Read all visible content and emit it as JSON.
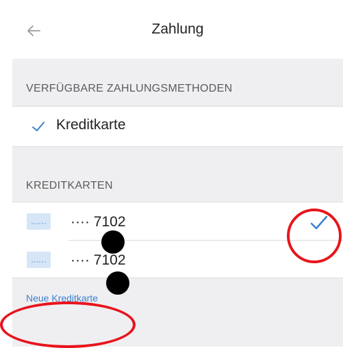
{
  "header": {
    "title": "Zahlung",
    "back_icon": "back-arrow-icon"
  },
  "payment_methods": {
    "section_title": "VERFÜGBARE ZAHLUNGSMETHODEN",
    "items": [
      {
        "label": "Kreditkarte",
        "selected": true
      }
    ]
  },
  "credit_cards": {
    "section_title": "KREDITKARTEN",
    "cards": [
      {
        "number": "···· 7102",
        "selected": true
      },
      {
        "number": "···· 7102",
        "selected": false
      }
    ],
    "new_card_label": "Neue Kreditkarte"
  },
  "colors": {
    "accent": "#3a7fd0",
    "annotation_red": "#e8141c",
    "background_gray": "#efeff1"
  }
}
